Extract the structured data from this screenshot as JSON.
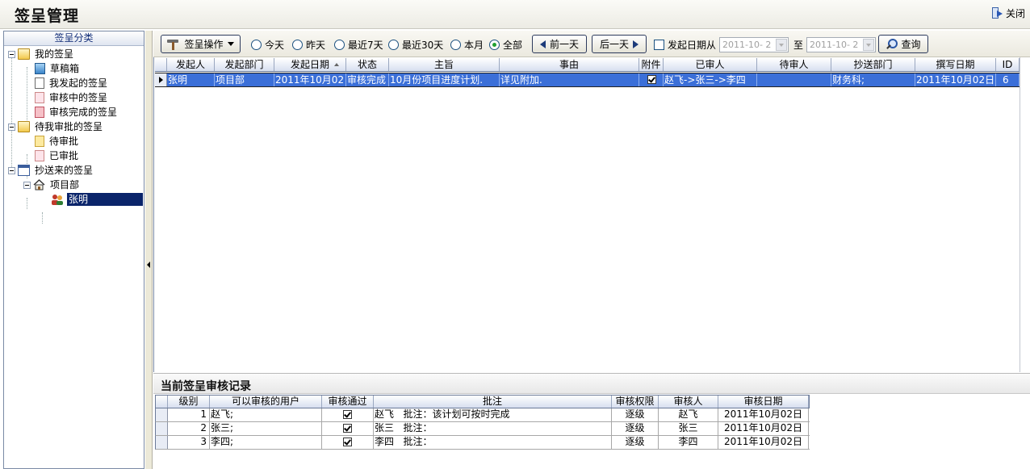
{
  "window": {
    "title": "签呈管理",
    "close_label": "关闭"
  },
  "sidebar": {
    "header": "签呈分类",
    "tree": [
      {
        "label": "我的签呈",
        "icon": "folder-icon"
      },
      {
        "label": "草稿箱",
        "icon": "inbox-icon"
      },
      {
        "label": "我发起的签呈",
        "icon": "document-icon"
      },
      {
        "label": "审核中的签呈",
        "icon": "document-pink-icon"
      },
      {
        "label": "审核完成的签呈",
        "icon": "document-red-icon"
      },
      {
        "label": "待我审批的签呈",
        "icon": "folder-icon"
      },
      {
        "label": "待审批",
        "icon": "document-yellow-icon"
      },
      {
        "label": "已审批",
        "icon": "document-pink-icon"
      },
      {
        "label": "抄送来的签呈",
        "icon": "calendar-icon"
      },
      {
        "label": "项目部",
        "icon": "home-icon"
      },
      {
        "label": "张明",
        "icon": "user-icon",
        "selected": true
      }
    ]
  },
  "toolbar": {
    "action_menu": "签呈操作",
    "radios": [
      {
        "label": "今天",
        "checked": false
      },
      {
        "label": "昨天",
        "checked": false
      },
      {
        "label": "最近7天",
        "checked": false
      },
      {
        "label": "最近30天",
        "checked": false
      },
      {
        "label": "本月",
        "checked": false
      },
      {
        "label": "全部",
        "checked": true
      }
    ],
    "prev_day": "前一天",
    "next_day": "后一天",
    "date_from_label": "发起日期从",
    "date_from": "2011-10- 2",
    "to_label": "至",
    "date_to": "2011-10- 2",
    "query": "查询"
  },
  "main_grid": {
    "columns": [
      "发起人",
      "发起部门",
      "发起日期",
      "状态",
      "主旨",
      "事由",
      "附件",
      "已审人",
      "待审人",
      "抄送部门",
      "撰写日期",
      "ID"
    ],
    "rows": [
      [
        "张明",
        "项目部",
        "2011年10月02日",
        "审核完成",
        "10月份项目进度计划.",
        "详见附加.",
        "✓",
        "赵飞->张三->李四",
        "",
        "财务科;",
        "2011年10月02日",
        "6"
      ]
    ]
  },
  "review_section": {
    "title": "当前签呈审核记录",
    "columns": [
      "级别",
      "可以审核的用户",
      "审核通过",
      "批注",
      "审核权限",
      "审核人",
      "审核日期"
    ],
    "rows": [
      [
        "1",
        "赵飞;",
        "✓",
        "赵飞   批注：该计划可按时完成",
        "逐级",
        "赵飞",
        "2011年10月02日"
      ],
      [
        "2",
        "张三;",
        "✓",
        "张三   批注：",
        "逐级",
        "张三",
        "2011年10月02日"
      ],
      [
        "3",
        "李四;",
        "✓",
        "李四   批注：",
        "逐级",
        "李四",
        "2011年10月02日"
      ]
    ]
  },
  "colors": {
    "selection": "#3b6fd8",
    "tree_selection": "#0a246a",
    "header_text": "#15307a"
  }
}
